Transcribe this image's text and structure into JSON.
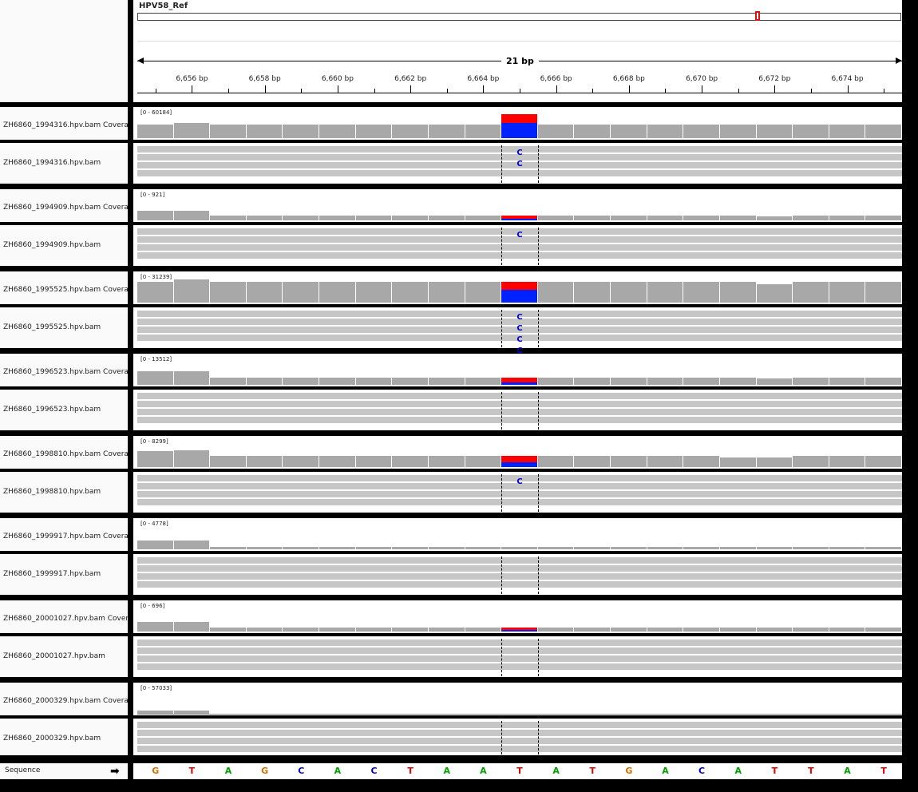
{
  "header": {
    "chromosome": "HPV58_Ref",
    "span_label": "21 bp",
    "ruler_ticks": [
      "6,656 bp",
      "6,658 bp",
      "6,660 bp",
      "6,662 bp",
      "6,664 bp",
      "6,666 bp",
      "6,668 bp",
      "6,670 bp",
      "6,672 bp",
      "6,674 bp"
    ]
  },
  "colors": {
    "coverage": "#a8a8a8",
    "mismatch_T": "#ff0000",
    "mismatch_C": "#0022ff",
    "read": "#c6c6c6",
    "base_A": "#00a000",
    "base_C": "#0000c0",
    "base_G": "#d07000",
    "base_T": "#e00000"
  },
  "tracks": [
    {
      "coverage_label": "ZH6860_1994316.hpv.bam Coverage",
      "alignment_label": "ZH6860_1994316.hpv.bam",
      "range": "[0 - 60184]",
      "coverage_levels": [
        0.55,
        0.62,
        0.55,
        0.55,
        0.55,
        0.55,
        0.55,
        0.55,
        0.55,
        0.55,
        1.0,
        0.55,
        0.55,
        0.55,
        0.55,
        0.55,
        0.55,
        0.55,
        0.55,
        0.55,
        0.55
      ],
      "mismatch_red_fraction": 0.35,
      "variant_marks": [
        "C",
        "C"
      ]
    },
    {
      "coverage_label": "ZH6860_1994909.hpv.bam Coverage",
      "alignment_label": "ZH6860_1994909.hpv.bam",
      "range": "[0 - 921]",
      "coverage_levels": [
        0.4,
        0.4,
        0.2,
        0.2,
        0.2,
        0.2,
        0.2,
        0.2,
        0.2,
        0.2,
        0.2,
        0.2,
        0.2,
        0.2,
        0.2,
        0.2,
        0.2,
        0.15,
        0.2,
        0.2,
        0.2
      ],
      "mismatch_red_fraction": 0.6,
      "variant_marks": [
        "C"
      ]
    },
    {
      "coverage_label": "ZH6860_1995525.hpv.bam Coverage",
      "alignment_label": "ZH6860_1995525.hpv.bam",
      "range": "[0 - 31239]",
      "coverage_levels": [
        0.85,
        0.95,
        0.85,
        0.85,
        0.85,
        0.85,
        0.85,
        0.85,
        0.85,
        0.85,
        0.85,
        0.85,
        0.85,
        0.85,
        0.85,
        0.85,
        0.85,
        0.75,
        0.85,
        0.85,
        0.85
      ],
      "mismatch_red_fraction": 0.4,
      "variant_marks": [
        "C",
        "C",
        "C",
        "C"
      ]
    },
    {
      "coverage_label": "ZH6860_1996523.hpv.bam Coverage",
      "alignment_label": "ZH6860_1996523.hpv.bam",
      "range": "[0 - 13512]",
      "coverage_levels": [
        0.55,
        0.55,
        0.3,
        0.3,
        0.3,
        0.3,
        0.3,
        0.3,
        0.3,
        0.3,
        0.3,
        0.3,
        0.3,
        0.3,
        0.3,
        0.3,
        0.3,
        0.25,
        0.3,
        0.3,
        0.3
      ],
      "mismatch_red_fraction": 0.7,
      "variant_marks": []
    },
    {
      "coverage_label": "ZH6860_1998810.hpv.bam Coverage",
      "alignment_label": "ZH6860_1998810.hpv.bam",
      "range": "[0 - 8299]",
      "coverage_levels": [
        0.65,
        0.7,
        0.45,
        0.45,
        0.45,
        0.45,
        0.45,
        0.45,
        0.45,
        0.45,
        0.45,
        0.45,
        0.45,
        0.45,
        0.45,
        0.45,
        0.4,
        0.4,
        0.45,
        0.45,
        0.45
      ],
      "mismatch_red_fraction": 0.6,
      "variant_marks": [
        "C"
      ]
    },
    {
      "coverage_label": "ZH6860_1999917.hpv.bam Coverage",
      "alignment_label": "ZH6860_1999917.hpv.bam",
      "range": "[0 - 4778]",
      "coverage_levels": [
        0.35,
        0.35,
        0.1,
        0.1,
        0.1,
        0.1,
        0.1,
        0.1,
        0.1,
        0.1,
        0.1,
        0.1,
        0.1,
        0.1,
        0.1,
        0.1,
        0.1,
        0.1,
        0.1,
        0.1,
        0.1
      ],
      "mismatch_red_fraction": 0,
      "variant_marks": []
    },
    {
      "coverage_label": "ZH6860_20001027.hpv.bam Coverage",
      "alignment_label": "ZH6860_20001027.hpv.bam",
      "range": "[0 - 696]",
      "coverage_levels": [
        0.4,
        0.4,
        0.15,
        0.15,
        0.15,
        0.15,
        0.15,
        0.15,
        0.15,
        0.15,
        0.15,
        0.15,
        0.15,
        0.15,
        0.15,
        0.15,
        0.15,
        0.15,
        0.15,
        0.15,
        0.15
      ],
      "mismatch_red_fraction": 0.6,
      "variant_marks": []
    },
    {
      "coverage_label": "ZH6860_2000329.hpv.bam Coverage",
      "alignment_label": "ZH6860_2000329.hpv.bam",
      "range": "[0 - 57033]",
      "coverage_levels": [
        0.12,
        0.12,
        0,
        0,
        0,
        0,
        0,
        0,
        0,
        0,
        0,
        0,
        0,
        0,
        0,
        0,
        0,
        0,
        0,
        0,
        0
      ],
      "mismatch_red_fraction": 0,
      "variant_marks": []
    }
  ],
  "sequence": {
    "label": "Sequence",
    "arrow": "➡",
    "bases": [
      "G",
      "T",
      "A",
      "G",
      "C",
      "A",
      "C",
      "T",
      "A",
      "A",
      "T",
      "A",
      "T",
      "G",
      "A",
      "C",
      "A",
      "T",
      "T",
      "A",
      "T"
    ]
  }
}
